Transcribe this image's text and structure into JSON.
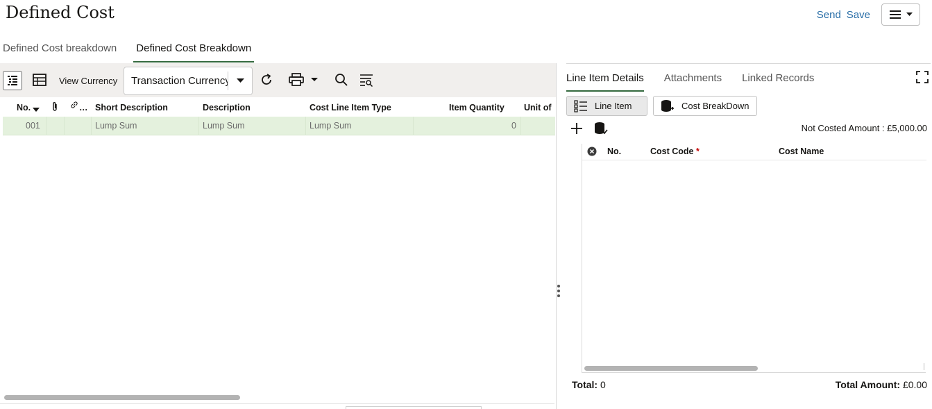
{
  "header": {
    "title": "Defined Cost",
    "send_label": "Send",
    "save_label": "Save",
    "menu_icon": "hamburger-icon"
  },
  "top_tabs": [
    {
      "label": "Defined Cost breakdown",
      "active": false
    },
    {
      "label": "Defined Cost Breakdown",
      "active": true
    }
  ],
  "left_toolbar": {
    "view_currency_label": "View Currency",
    "currency_value": "Transaction Currency",
    "icons": [
      "list-select-icon",
      "table-icon",
      "refresh-icon",
      "print-icon",
      "search-icon",
      "filter-list-icon"
    ]
  },
  "left_grid": {
    "columns": [
      "No.",
      "",
      "…",
      "Short Description",
      "Description",
      "Cost Line Item Type",
      "Item Quantity",
      "Unit of"
    ],
    "rows": [
      {
        "no": "001",
        "short_description": "Lump Sum",
        "description": "Lump Sum",
        "cost_line_item_type": "Lump Sum",
        "item_quantity": "0"
      }
    ]
  },
  "right_panel": {
    "tabs": [
      {
        "label": "Line Item Details",
        "active": true
      },
      {
        "label": "Attachments",
        "active": false
      },
      {
        "label": "Linked Records",
        "active": false
      }
    ],
    "segment_buttons": [
      {
        "label": "Line Item",
        "selected": true
      },
      {
        "label": "Cost BreakDown",
        "selected": false
      }
    ],
    "not_costed_amount": "Not Costed Amount : £5,000.00",
    "grid_columns": {
      "no": "No.",
      "cost_code": "Cost Code",
      "cost_code_required": "*",
      "cost_name": "Cost Name"
    },
    "total_label": "Total:",
    "total_value": "0",
    "total_amount_label": "Total Amount:",
    "total_amount_value": "£0.00"
  },
  "colors": {
    "accent_green": "#356a3f",
    "link_blue": "#2a6fa8",
    "selected_row": "#e4f1dd",
    "toolbar_bg": "#f1efed"
  }
}
